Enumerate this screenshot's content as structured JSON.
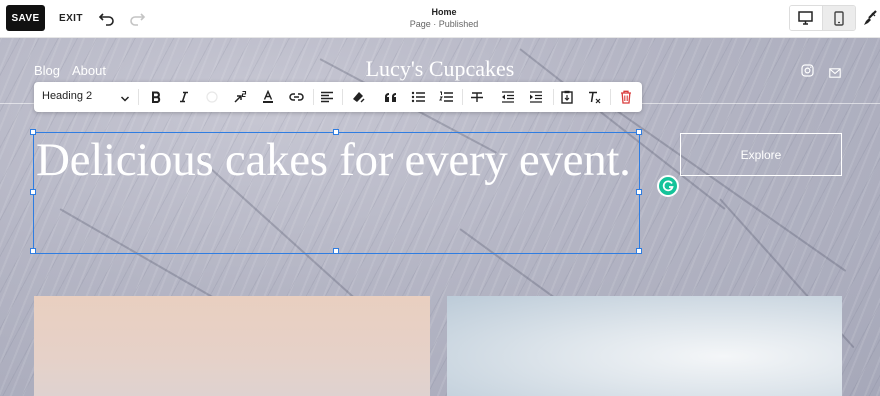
{
  "editor": {
    "save_label": "SAVE",
    "exit_label": "EXIT",
    "undo_icon": "undo-icon",
    "redo_icon": "redo-icon",
    "page_title": "Home",
    "page_status": "Page · Published",
    "view_desktop_icon": "desktop-icon",
    "view_mobile_icon": "mobile-icon",
    "style_icon": "paint-brush-icon"
  },
  "site": {
    "nav": [
      "Blog",
      "About"
    ],
    "title": "Lucy's Cupcakes",
    "social_icons": [
      "instagram-icon",
      "email-icon"
    ],
    "heading": "Delicious cakes for every event.",
    "button_label": "Explore"
  },
  "format_toolbar": {
    "text_style": "Heading 2",
    "tools": [
      "bold",
      "italic",
      "color",
      "superscript",
      "text-color",
      "link",
      "align",
      "highlight",
      "quote",
      "bulleted-list",
      "numbered-list",
      "strikethrough",
      "outdent",
      "indent",
      "paste",
      "clear-format",
      "delete"
    ]
  },
  "colors": {
    "selection": "#2f7de1",
    "delete": "#d93a3a",
    "grammarly": "#15c39a"
  }
}
